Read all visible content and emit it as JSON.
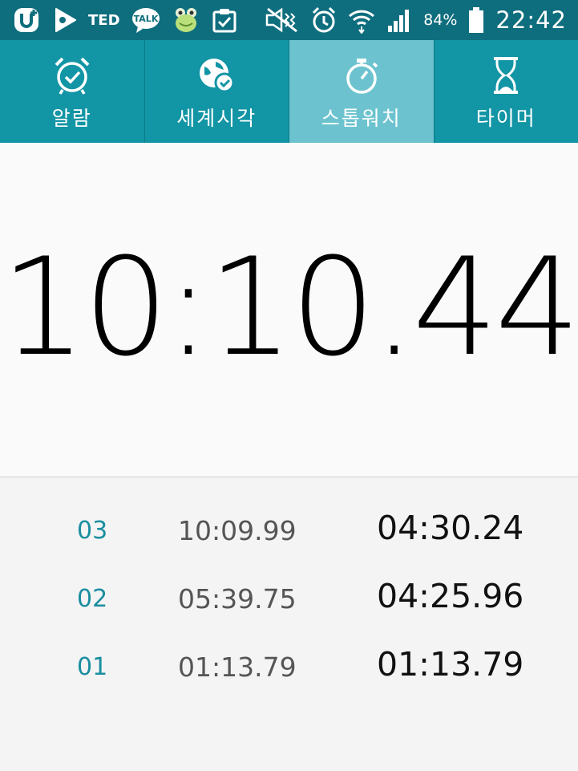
{
  "status_bar": {
    "icons_left": [
      "u-plus-icon",
      "play-store-icon",
      "ted-icon",
      "kakaotalk-icon",
      "frog-app-icon",
      "clipboard-check-icon"
    ],
    "ted_label": "TED",
    "talk_label": "TALK",
    "icons_right": [
      "mute-icon",
      "alarm-icon",
      "wifi-icon",
      "signal-icon",
      "battery-icon"
    ],
    "battery_percent": "84%",
    "clock": "22:42"
  },
  "tabs": [
    {
      "label": "알람",
      "icon": "alarm-clock-icon",
      "active": false
    },
    {
      "label": "세계시각",
      "icon": "globe-check-icon",
      "active": false
    },
    {
      "label": "스톱워치",
      "icon": "stopwatch-icon",
      "active": true
    },
    {
      "label": "타이머",
      "icon": "hourglass-icon",
      "active": false
    }
  ],
  "stopwatch": {
    "main_time": "10:10",
    "main_ms": ".44"
  },
  "laps": [
    {
      "number": "03",
      "total": "10:09.99",
      "split": "04:30.24"
    },
    {
      "number": "02",
      "total": "05:39.75",
      "split": "04:25.96"
    },
    {
      "number": "01",
      "total": "01:13.79",
      "split": "01:13.79"
    }
  ],
  "colors": {
    "status_bg": "#0f6e7e",
    "tab_bg": "#1295a5",
    "tab_active_bg": "#6cc3cf",
    "lap_number": "#1a8ea0"
  }
}
